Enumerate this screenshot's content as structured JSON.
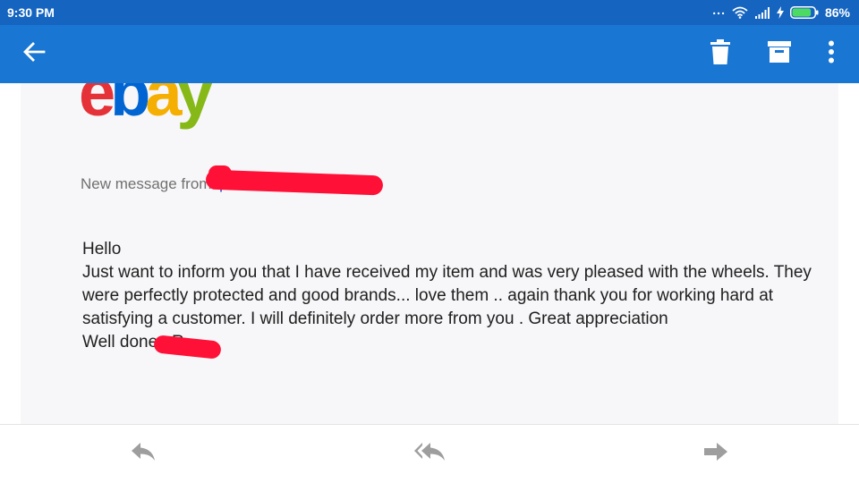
{
  "status_bar": {
    "time": "9:30 PM",
    "dots": "...",
    "battery_percent": "86%",
    "battery_level": 0.86,
    "icons": [
      "dots-icon",
      "wifi-icon",
      "signal-icon",
      "charging-icon",
      "battery-icon"
    ]
  },
  "toolbar": {
    "icons": [
      "back-arrow-icon",
      "trash-icon",
      "archive-icon",
      "more-vert-icon"
    ],
    "color": "#1976d2"
  },
  "email": {
    "logo": {
      "letters": [
        "e",
        "b",
        "a",
        "y"
      ],
      "colors": [
        "#e53238",
        "#0064d2",
        "#f5af02",
        "#86b817"
      ]
    },
    "sender_label": "New message from:",
    "sender_name": "p",
    "body": {
      "greeting": "Hello",
      "lines": [
        "Just want to inform you that I have received my item and was very pleased with the wheels. They",
        "were perfectly protected and good brands... love them .. again thank you for working hard at",
        "satisfying a customer. I will definitely order more from you . Great appreciation"
      ],
      "signoff": "Well done . R"
    }
  },
  "bottom_actions": {
    "icons": [
      "reply-icon",
      "reply-all-icon",
      "forward-icon"
    ],
    "icon_color": "#9e9e9e"
  }
}
